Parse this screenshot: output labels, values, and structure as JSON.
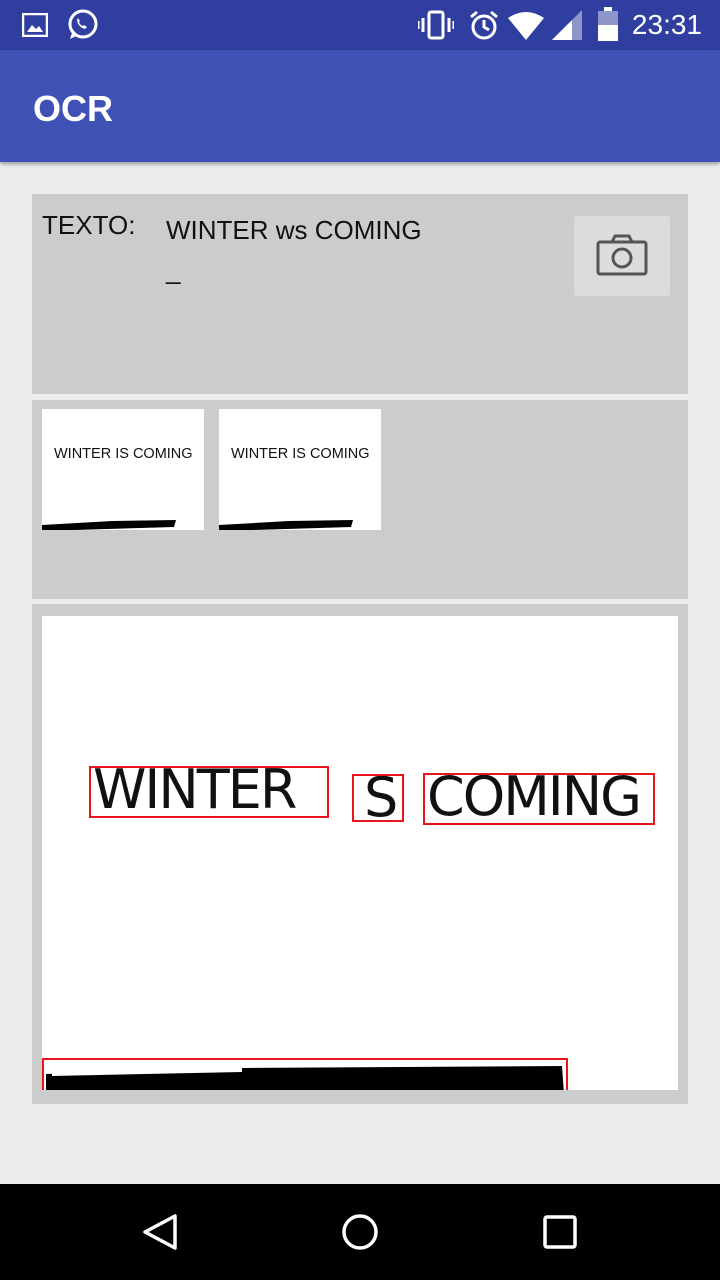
{
  "status_bar": {
    "time": "23:31",
    "left_icons": [
      "image-icon",
      "whatsapp-icon"
    ],
    "right_icons": [
      "vibrate-icon",
      "alarm-icon",
      "wifi-icon",
      "signal-icon",
      "battery-icon"
    ]
  },
  "app_bar": {
    "title": "OCR"
  },
  "text_panel": {
    "label": "TEXTO:",
    "value": "WINTER ws COMING\n_",
    "camera_icon": "camera-icon"
  },
  "thumbnails": [
    {
      "text": "WINTER IS COMING"
    },
    {
      "text": "WINTER IS COMING"
    }
  ],
  "preview": {
    "words": [
      "WINTER",
      "S",
      "COMING"
    ],
    "box_color": "#e8131b"
  },
  "nav_bar": {
    "icons": [
      "back-icon",
      "home-icon",
      "recents-icon"
    ]
  },
  "colors": {
    "primary": "#3f51b5",
    "primary_dark": "#303f9f",
    "panel": "#cccccc"
  }
}
